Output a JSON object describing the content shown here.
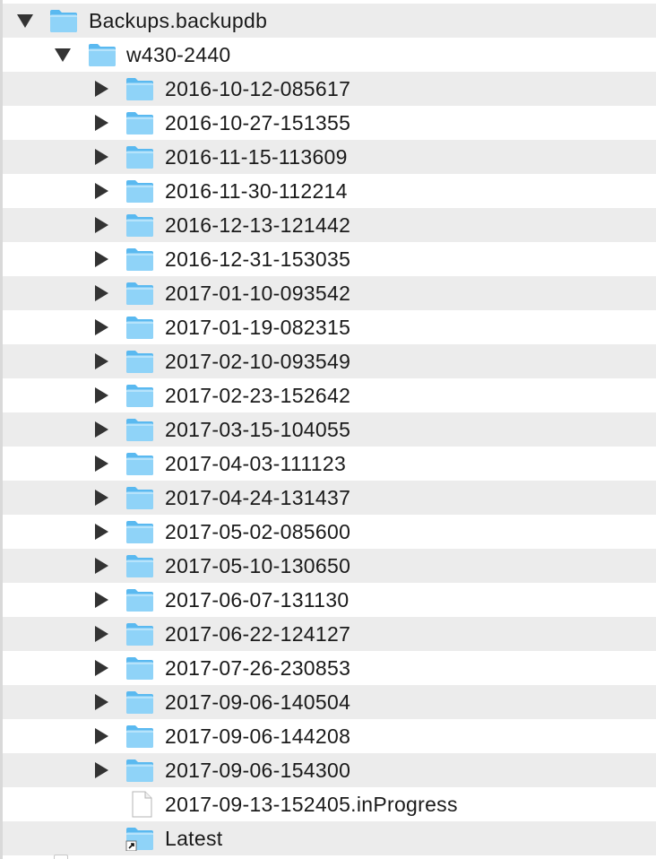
{
  "root": {
    "label": "Backups.backupdb",
    "expanded": true,
    "icon": "folder-icon"
  },
  "machine": {
    "label": "w430-2440",
    "expanded": true,
    "icon": "folder-icon"
  },
  "snapshots": [
    "2016-10-12-085617",
    "2016-10-27-151355",
    "2016-11-15-113609",
    "2016-11-30-112214",
    "2016-12-13-121442",
    "2016-12-31-153035",
    "2017-01-10-093542",
    "2017-01-19-082315",
    "2017-02-10-093549",
    "2017-02-23-152642",
    "2017-03-15-104055",
    "2017-04-03-111123",
    "2017-04-24-131437",
    "2017-05-02-085600",
    "2017-05-10-130650",
    "2017-06-07-131130",
    "2017-06-22-124127",
    "2017-07-26-230853",
    "2017-09-06-140504",
    "2017-09-06-144208",
    "2017-09-06-154300"
  ],
  "in_progress": {
    "label": "2017-09-13-152405.inProgress",
    "icon": "document-icon"
  },
  "latest": {
    "label": "Latest",
    "icon": "folder-alias-icon"
  },
  "colors": {
    "folder_light": "#8fd3f8",
    "folder_dark": "#5ab9f0",
    "row_alt": "#ececec",
    "text": "#1a1a1a"
  }
}
